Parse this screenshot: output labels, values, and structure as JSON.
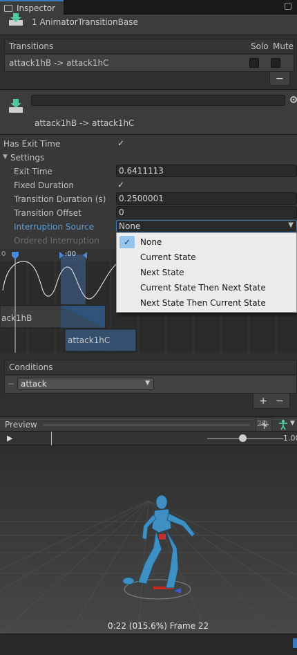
{
  "tab": {
    "title": "Inspector"
  },
  "header": {
    "title": "1 AnimatorTransitionBase"
  },
  "transitions": {
    "header": "Transitions",
    "solo": "Solo",
    "mute": "Mute",
    "row": "attack1hB -> attack1hC",
    "minus": "−"
  },
  "transition": {
    "name_value": "",
    "subtitle": "attack1hB -> attack1hC"
  },
  "props": {
    "has_exit_time": "Has Exit Time",
    "settings": "Settings",
    "exit_time": "Exit Time",
    "exit_time_value": "0.6411113",
    "fixed_duration": "Fixed Duration",
    "transition_duration": "Transition Duration (s)",
    "transition_duration_value": "0.2500001",
    "transition_offset": "Transition Offset",
    "transition_offset_value": "0",
    "interruption_source": "Interruption Source",
    "interruption_value": "None",
    "ordered_interruption": "Ordered Interruption"
  },
  "menu": {
    "items": [
      "None",
      "Current State",
      "Next State",
      "Current State Then Next State",
      "Next State Then Current State"
    ],
    "selected": "None"
  },
  "timeline": {
    "time_label": "0",
    "marker_label": ":00",
    "clip_a": "ack1hB",
    "clip_b": "attack1hC"
  },
  "conditions": {
    "header": "Conditions",
    "param": "attack",
    "plus": "+",
    "minus": "−"
  },
  "preview": {
    "title": "Preview",
    "mode_2d": "2D",
    "speed": "1.00",
    "status": "0:22 (015.6%) Frame 22"
  },
  "colors": {
    "accent": "#3a79bb",
    "link_label": "#5b9bd5",
    "menu_bg": "#ececec",
    "menu_check": "#96c4ec"
  }
}
